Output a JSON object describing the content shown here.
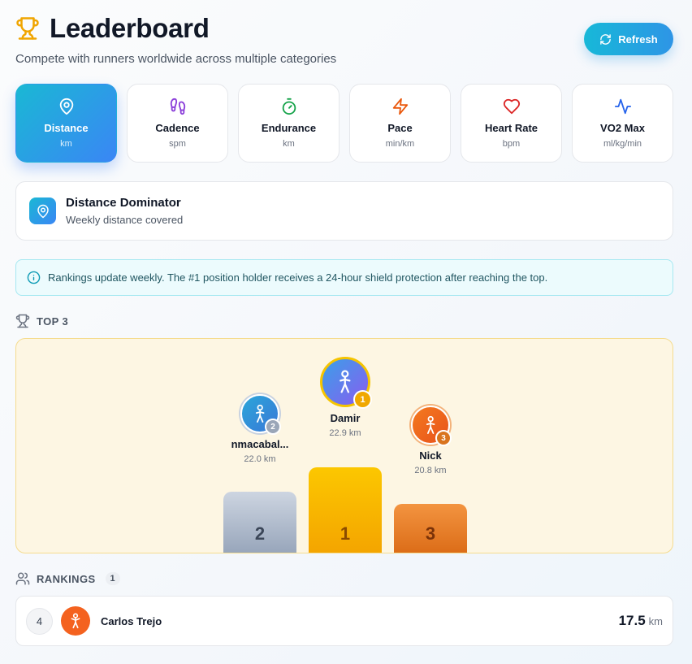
{
  "header": {
    "title": "Leaderboard",
    "subtitle": "Compete with runners worldwide across multiple categories",
    "refresh_label": "Refresh"
  },
  "categories": [
    {
      "name": "Distance",
      "unit": "km",
      "icon": "map-pin-icon",
      "active": true
    },
    {
      "name": "Cadence",
      "unit": "spm",
      "icon": "footprints-icon"
    },
    {
      "name": "Endurance",
      "unit": "km",
      "icon": "timer-icon"
    },
    {
      "name": "Pace",
      "unit": "min/km",
      "icon": "lightning-icon"
    },
    {
      "name": "Heart Rate",
      "unit": "bpm",
      "icon": "heart-icon"
    },
    {
      "name": "VO2 Max",
      "unit": "ml/kg/min",
      "icon": "activity-icon"
    }
  ],
  "category_card": {
    "title": "Distance Dominator",
    "description": "Weekly distance covered"
  },
  "notice": "Rankings update weekly. The #1 position holder receives a 24-hour shield protection after reaching the top.",
  "top3": {
    "label": "TOP 3",
    "podium": [
      {
        "rank": "2",
        "name": "nmacabal...",
        "distance": "22.0 km"
      },
      {
        "rank": "1",
        "name": "Damir",
        "distance": "22.9 km"
      },
      {
        "rank": "3",
        "name": "Nick",
        "distance": "20.8 km"
      }
    ]
  },
  "rankings": {
    "label": "RANKINGS",
    "count": "1",
    "rows": [
      {
        "rank": "4",
        "name": "Carlos Trejo",
        "value": "17.5",
        "unit": "km"
      }
    ]
  },
  "colors": {
    "accent": "#2e95e6",
    "gold": "#f5b400",
    "silver": "#a9b4c4",
    "bronze": "#e8772b"
  }
}
